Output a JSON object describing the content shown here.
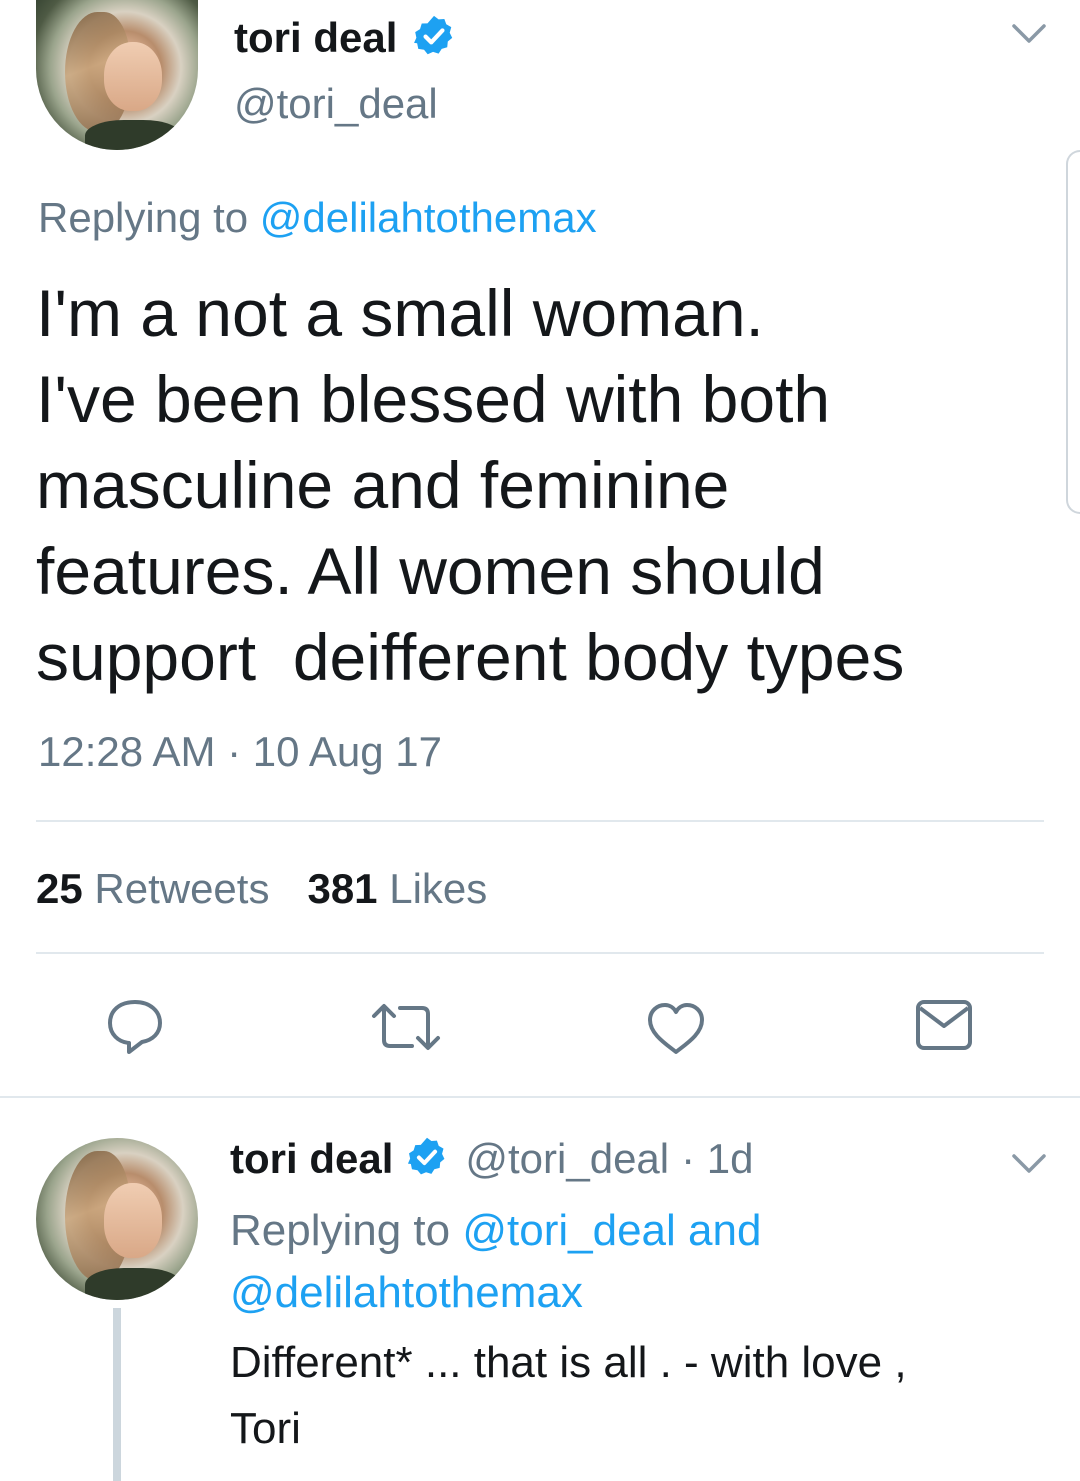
{
  "main_tweet": {
    "author_name": "tori deal",
    "author_handle": "@tori_deal",
    "replying_prefix": "Replying to ",
    "replying_to": "@delilahtothemax",
    "text_lines": [
      "I'm a not a small woman.",
      "I've been blessed with both",
      "masculine and feminine",
      "features. All women should",
      "support  deifferent body types"
    ],
    "time": "12:28 AM",
    "date_sep": " · ",
    "date": "10 Aug 17",
    "retweets_count": "25",
    "retweets_label": " Retweets",
    "likes_count": "381",
    "likes_label": " Likes"
  },
  "actions": {
    "reply_icon": "reply-icon",
    "retweet_icon": "retweet-icon",
    "like_icon": "heart-icon",
    "dm_icon": "envelope-icon"
  },
  "reply_tweet": {
    "author_name": "tori deal",
    "author_handle": "@tori_deal",
    "age": "· 1d",
    "replying_prefix": "Replying to ",
    "replying_to_1": "@tori_deal and",
    "replying_to_2": "@delilahtothemax",
    "text_line_1": "Different* ... that is all . - with love ,",
    "text_line_2": "Tori"
  },
  "colors": {
    "text": "#14171a",
    "secondary": "#657786",
    "link": "#1da1f2",
    "verified": "#1da1f2",
    "divider": "#e1e8ed"
  }
}
